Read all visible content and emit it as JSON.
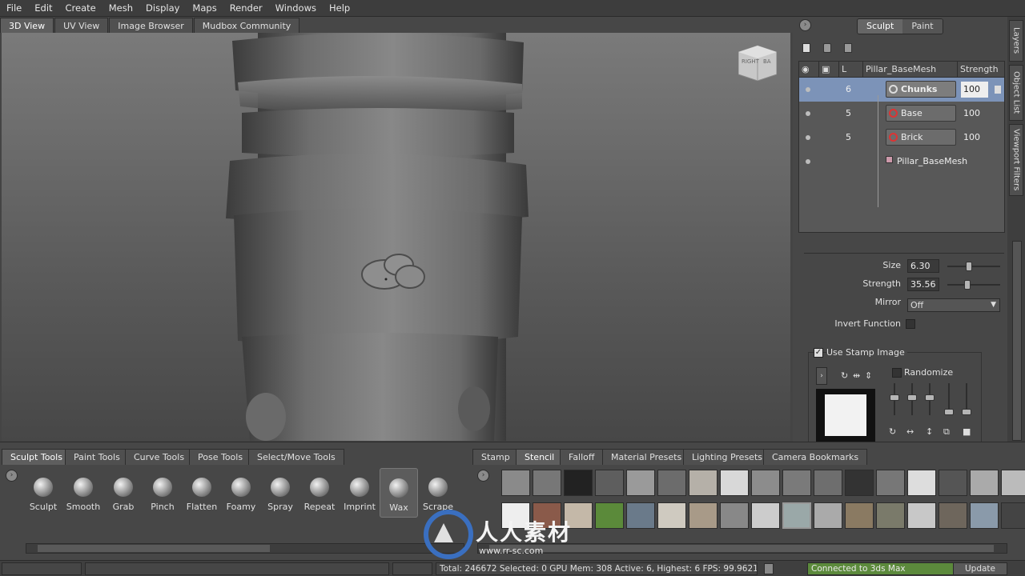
{
  "menu": [
    "File",
    "Edit",
    "Create",
    "Mesh",
    "Display",
    "Maps",
    "Render",
    "Windows",
    "Help"
  ],
  "view_tabs": [
    "3D View",
    "UV View",
    "Image Browser",
    "Mudbox Community"
  ],
  "viewcube": {
    "left": "RIGHT",
    "right": "BA"
  },
  "mode_tabs": [
    "Sculpt",
    "Paint"
  ],
  "side_tabs": [
    "Layers",
    "Object List",
    "Viewport Filters"
  ],
  "layers": {
    "headers": {
      "level": "L",
      "name": "Pillar_BaseMesh",
      "strength": "Strength"
    },
    "rows": [
      {
        "level": "6",
        "name": "Chunks",
        "strength": "100",
        "selected": true
      },
      {
        "level": "5",
        "name": "Base",
        "strength": "100",
        "selected": false
      },
      {
        "level": "5",
        "name": "Brick",
        "strength": "100",
        "selected": false
      }
    ],
    "mesh_name": "Pillar_BaseMesh"
  },
  "properties": {
    "size_label": "Size",
    "size_value": "6.30",
    "size_level": 0.4,
    "strength_label": "Strength",
    "strength_value": "35.56",
    "strength_level": 0.36,
    "mirror_label": "Mirror",
    "mirror_value": "Off",
    "invert_label": "Invert Function",
    "use_stamp_label": "Use Stamp Image",
    "randomize_label": "Randomize"
  },
  "tool_tabs": [
    "Sculpt Tools",
    "Paint Tools",
    "Curve Tools",
    "Pose Tools",
    "Select/Move Tools"
  ],
  "tools": [
    "Sculpt",
    "Smooth",
    "Grab",
    "Pinch",
    "Flatten",
    "Foamy",
    "Spray",
    "Repeat",
    "Imprint",
    "Wax",
    "Scrape"
  ],
  "active_tool": "Wax",
  "tray_tabs": [
    "Stamp",
    "Stencil",
    "Falloff",
    "Material Presets",
    "Lighting Presets",
    "Camera Bookmarks"
  ],
  "active_tray_tab": "Stencil",
  "status": {
    "info": "Total: 246672 Selected: 0 GPU Mem: 308  Active: 6, Highest: 6  FPS: 99.9621",
    "connection": "Connected to 3ds Max",
    "update_button": "Update"
  },
  "watermark": {
    "text": "人人素材",
    "sub": "www.rr-sc.com"
  },
  "colors": {
    "selection": "#7c93b8",
    "connected": "#5c8a3c"
  }
}
